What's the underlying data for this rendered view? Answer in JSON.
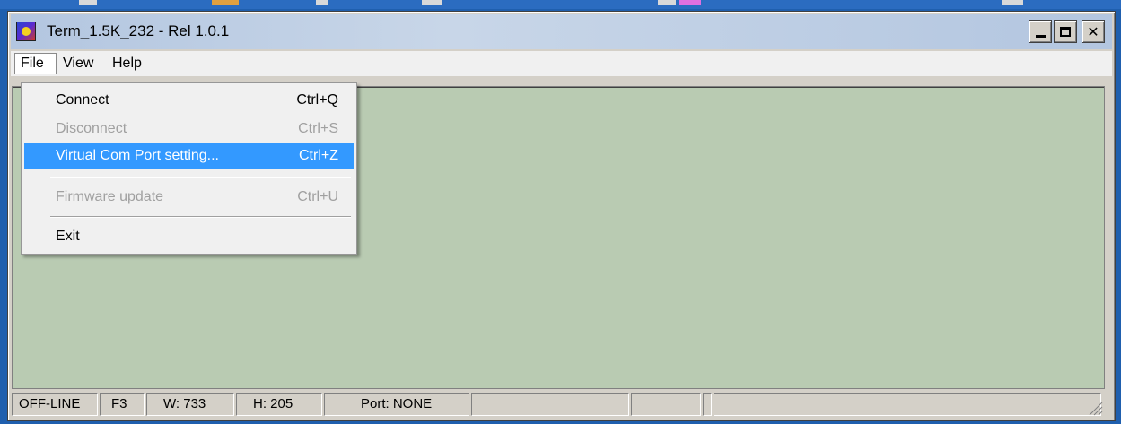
{
  "window": {
    "title": "Term_1.5K_232 - Rel 1.0.1",
    "client_background": "#b9cbb2",
    "icon": "app-icon"
  },
  "menubar": {
    "items": [
      {
        "label": "File"
      },
      {
        "label": "View"
      },
      {
        "label": "Help"
      }
    ]
  },
  "file_menu": {
    "items": [
      {
        "label": "Connect",
        "shortcut": "Ctrl+Q",
        "enabled": true,
        "highlighted": false
      },
      {
        "label": "Disconnect",
        "shortcut": "Ctrl+S",
        "enabled": false,
        "highlighted": false
      },
      {
        "label": "Virtual Com Port setting...",
        "shortcut": "Ctrl+Z",
        "enabled": true,
        "highlighted": true
      },
      {
        "label": "Firmware update",
        "shortcut": "Ctrl+U",
        "enabled": false,
        "highlighted": false
      },
      {
        "label": "Exit",
        "shortcut": "",
        "enabled": true,
        "highlighted": false
      }
    ],
    "highlight_color": "#3399ff"
  },
  "statusbar": {
    "cells": [
      "OFF-LINE",
      "F3",
      "W: 733",
      "H: 205",
      "Port: NONE",
      "",
      "",
      "",
      ""
    ]
  }
}
